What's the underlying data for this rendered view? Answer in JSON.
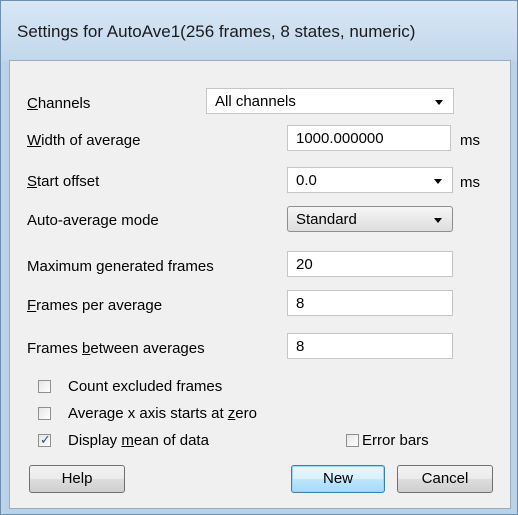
{
  "window": {
    "title": "Settings for AutoAve1(256 frames, 8 states, numeric)"
  },
  "rows": {
    "channels": {
      "label_first": "C",
      "label_rest": "hannels",
      "value": "All channels"
    },
    "width": {
      "label_first": "W",
      "label_rest": "idth of average",
      "value": "1000.000000",
      "unit": "ms"
    },
    "start": {
      "label_first": "S",
      "label_rest": "tart offset",
      "value": "0.0",
      "unit": "ms"
    },
    "mode": {
      "label": "Auto-average mode",
      "value": "Standard"
    },
    "maxframes": {
      "label": "Maximum generated frames",
      "value": "20"
    },
    "perave": {
      "label_first": "F",
      "label_rest": "rames per average",
      "value": "8"
    },
    "between": {
      "label_pre": "Frames ",
      "label_u": "b",
      "label_post": "etween averages",
      "value": "8"
    }
  },
  "checkboxes": {
    "count_excluded": {
      "label": "Count excluded frames",
      "checked": false
    },
    "xaxis_zero": {
      "label_pre": "Average x axis starts at ",
      "label_u": "z",
      "label_post": "ero",
      "checked": false
    },
    "display_mean": {
      "label_pre": "Display ",
      "label_u": "m",
      "label_post": "ean of data",
      "checked": true
    },
    "error_bars": {
      "label": "Error bars",
      "checked": false
    }
  },
  "buttons": {
    "help": "Help",
    "new": "New",
    "cancel": "Cancel"
  },
  "icons": {
    "check": "✓"
  }
}
